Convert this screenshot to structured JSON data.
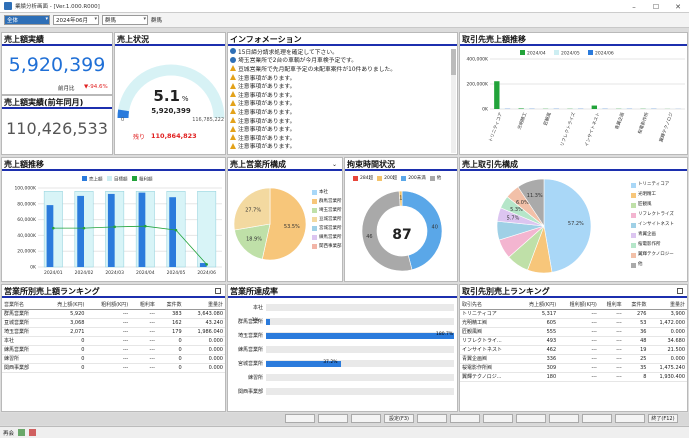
{
  "window": {
    "title": "業績分析画面 - [Ver.1.000.R000]"
  },
  "toolbar": {
    "company": "全体",
    "month": "2024年06月",
    "dept_select": "群馬",
    "dept_label": "群馬"
  },
  "sales": {
    "title": "売上額実績",
    "value": "5,920,399",
    "yoy_label": "前月比",
    "yoy_value": "▼-94.6%"
  },
  "sales_prev": {
    "title": "売上額実績(前年同月)",
    "value": "110,426,533"
  },
  "status": {
    "title": "売上状況",
    "percent": "5.1",
    "percent_unit": "%",
    "current": "5,920,399",
    "min": "0",
    "max": "116,785,222",
    "remain_label": "残り",
    "remain_value": "110,864,823",
    "progress": 0.051
  },
  "info": {
    "title": "インフォメーション",
    "items": [
      {
        "icon": "info",
        "text": "15日締分請求処理を確定して下さい。"
      },
      {
        "icon": "info",
        "text": "埼玉営業所で2台の車輌が今月車検予定です。"
      },
      {
        "icon": "warn",
        "text": "亘城営業所で先月配車予定の未配車案件が10件ありました。"
      },
      {
        "icon": "warn",
        "text": "注意事項があります。"
      },
      {
        "icon": "warn",
        "text": "注意事項があります。"
      },
      {
        "icon": "warn",
        "text": "注意事項があります。"
      },
      {
        "icon": "warn",
        "text": "注意事項があります。"
      },
      {
        "icon": "warn",
        "text": "注意事項があります。"
      },
      {
        "icon": "warn",
        "text": "注意事項があります。"
      },
      {
        "icon": "warn",
        "text": "注意事項があります。"
      },
      {
        "icon": "warn",
        "text": "注意事項があります。"
      },
      {
        "icon": "warn",
        "text": "注意事項があります。"
      }
    ]
  },
  "client_trend": {
    "title": "取引先売上額推移",
    "chart_data": {
      "type": "bar",
      "categories": [
        "トリニティコア",
        "光明精工",
        "匠観風",
        "リフレクトライズ",
        "インサイトネスト",
        "青翼企画",
        "桜電影作所",
        "翼輝テクノロジ"
      ],
      "series": [
        {
          "name": "2024/04",
          "color": "#22a33a",
          "values": [
            2500,
            50,
            20,
            20,
            310,
            20,
            20,
            10
          ]
        },
        {
          "name": "2024/05",
          "color": "#cdeef2",
          "values": [
            20,
            20,
            20,
            20,
            20,
            20,
            20,
            10
          ]
        },
        {
          "name": "2024/06",
          "color": "#2b7bdc",
          "values": [
            20,
            20,
            20,
            20,
            20,
            20,
            20,
            10
          ]
        }
      ],
      "yticks": [
        "400,000K",
        "200,000K",
        "0K"
      ],
      "ylim": [
        0,
        4500
      ]
    }
  },
  "sales_trend": {
    "title": "売上額推移",
    "legend": [
      "売上額",
      "目標額",
      "粗利額"
    ],
    "chart_data": {
      "type": "bar",
      "categories": [
        "2024/01",
        "2024/02",
        "2024/03",
        "2024/04",
        "2024/05",
        "2024/06"
      ],
      "series": [
        {
          "name": "売上額",
          "color": "#2b7bdc",
          "values": [
            94000,
            108000,
            111000,
            113000,
            106000,
            6000
          ]
        },
        {
          "name": "目標額",
          "color": "#d8f4f7",
          "values": [
            115000,
            115000,
            115000,
            115000,
            115000,
            115000
          ]
        },
        {
          "name": "粗利額",
          "color": "#22a33a",
          "values": [
            59000,
            59000,
            61000,
            62000,
            56000,
            4000
          ]
        }
      ],
      "yticks": [
        "100,000K",
        "80,000K",
        "60,000K",
        "40,000K",
        "20,000K",
        "0K"
      ],
      "ylim": [
        0,
        120000
      ]
    }
  },
  "office_comp": {
    "title": "売上営業所構成",
    "legend": [
      "本社",
      "群馬営業所",
      "埼玉営業所",
      "亘城営業所",
      "宮城営業所",
      "練馬営業所",
      "関西事業部"
    ],
    "legend_colors": [
      "#a9d7f7",
      "#f7c67a",
      "#bfe0a8",
      "#f3d9a0",
      "#9fd0e6",
      "#dcc5f0",
      "#f2b5a8"
    ],
    "chart_data": {
      "type": "pie",
      "labels": [
        "群馬営業所",
        "埼玉営業所",
        "亘城営業所"
      ],
      "values": [
        53.5,
        18.9,
        27.7
      ],
      "display": [
        "53.5%",
        "18.9%",
        "27.7%"
      ],
      "colors": [
        "#f7c67a",
        "#bfe0a8",
        "#f3d9a0"
      ]
    }
  },
  "bind_time": {
    "title": "拘束時間状況",
    "legend": [
      "284超",
      "200超",
      "200未満",
      "他"
    ],
    "legend_colors": [
      "#e8463a",
      "#f3c36b",
      "#5aa7e8",
      "#a9a9a9"
    ],
    "center": "87",
    "chart_data": {
      "type": "pie",
      "labels": [
        "200未満",
        "他",
        "200超"
      ],
      "values": [
        40,
        46,
        1
      ],
      "display": [
        "40",
        "46",
        "1"
      ],
      "colors": [
        "#5aa7e8",
        "#a9a9a9",
        "#f3c36b"
      ]
    }
  },
  "client_comp": {
    "title": "売上取引先構成",
    "legend": [
      "トリニティコア",
      "光明精工",
      "匠観風",
      "リフレクトライズ",
      "インサイトネスト",
      "青翼企画",
      "桜電影作所",
      "翼輝テクノロジー",
      "他"
    ],
    "legend_colors": [
      "#a9d7f7",
      "#f7c67a",
      "#bfe0a8",
      "#f3b5d0",
      "#9fd0e6",
      "#dcc5f0",
      "#b5e6c9",
      "#f2c0a8",
      "#aaaaaa"
    ],
    "chart_data": {
      "type": "pie",
      "labels": [
        "トリニティコア",
        "光明精工",
        "匠観風",
        "リフレクトライズ",
        "インサイトネスト",
        "青翼企画",
        "桜電影作所",
        "翼輝テクノロジー",
        "他"
      ],
      "values": [
        57.2,
        10.2,
        9.4,
        8.1,
        7.8,
        5.7,
        5.3,
        6.0,
        11.3
      ],
      "display": [
        "57.2%",
        "",
        "",
        "",
        "",
        "5.7%",
        "5.3%",
        "6.0%",
        "11.3%"
      ],
      "colors": [
        "#a9d7f7",
        "#f7c67a",
        "#bfe0a8",
        "#f3b5d0",
        "#9fd0e6",
        "#dcc5f0",
        "#b5e6c9",
        "#f2c0a8",
        "#aaaaaa"
      ]
    }
  },
  "office_rank": {
    "title": "営業所別売上額ランキング",
    "columns": [
      "営業所名",
      "売上額(K円)",
      "粗利額(K円)",
      "粗利率",
      "案件数",
      "重量計"
    ],
    "rows": [
      [
        "群馬営業所",
        "5,920",
        "---",
        "---",
        "383",
        "3,643.080"
      ],
      [
        "亘城営業所",
        "3,068",
        "---",
        "---",
        "162",
        "43.240"
      ],
      [
        "埼玉営業所",
        "2,071",
        "---",
        "---",
        "179",
        "1,986.040"
      ],
      [
        "本社",
        "0",
        "---",
        "---",
        "0",
        "0.000"
      ],
      [
        "練馬営業所",
        "0",
        "---",
        "---",
        "0",
        "0.000"
      ],
      [
        "練習所",
        "0",
        "---",
        "---",
        "0",
        "0.000"
      ],
      [
        "関西事業部",
        "0",
        "---",
        "---",
        "0",
        "0.000"
      ]
    ]
  },
  "office_rate": {
    "title": "営業所達成率",
    "rows": [
      {
        "label": "本社",
        "value": 0,
        "text": "0"
      },
      {
        "label": "群馬営業所",
        "value": 2,
        "text": "1%"
      },
      {
        "label": "埼玉営業所",
        "value": 100,
        "text": "180.7%"
      },
      {
        "label": "練馬営業所",
        "value": 0,
        "text": "0"
      },
      {
        "label": "宮城営業所",
        "value": 40,
        "text": "37.2%"
      },
      {
        "label": "練習所",
        "value": 0,
        "text": "0"
      },
      {
        "label": "関西事業部",
        "value": 0,
        "text": "0"
      }
    ]
  },
  "client_rank": {
    "title": "取引先別売上ランキング",
    "columns": [
      "取引先名",
      "売上額(K円)",
      "粗利額(K円)",
      "粗利率",
      "案件数",
      "重量計"
    ],
    "rows": [
      [
        "トリニティコア",
        "5,317",
        "---",
        "---",
        "276",
        "3,900"
      ],
      [
        "光明精工㈱",
        "605",
        "---",
        "---",
        "53",
        "1,472.000"
      ],
      [
        "匠観風㈱",
        "555",
        "---",
        "---",
        "36",
        "0.000"
      ],
      [
        "リフレクトライ...",
        "493",
        "---",
        "---",
        "48",
        "34.680"
      ],
      [
        "インサイトネスト",
        "462",
        "---",
        "---",
        "19",
        "21.500"
      ],
      [
        "青翼企画㈱",
        "336",
        "---",
        "---",
        "25",
        "0.000"
      ],
      [
        "桜電影作所㈱",
        "309",
        "---",
        "---",
        "35",
        "1,475.240"
      ],
      [
        "翼輝テクノロジ...",
        "180",
        "---",
        "---",
        "8",
        "1,930.400"
      ]
    ]
  },
  "bottom": {
    "buttons": [
      "",
      "",
      "",
      "設定(F3)",
      "",
      "",
      "",
      "",
      "",
      "",
      "",
      "終了(F12)"
    ]
  },
  "statusbar": {
    "text": "再会"
  }
}
